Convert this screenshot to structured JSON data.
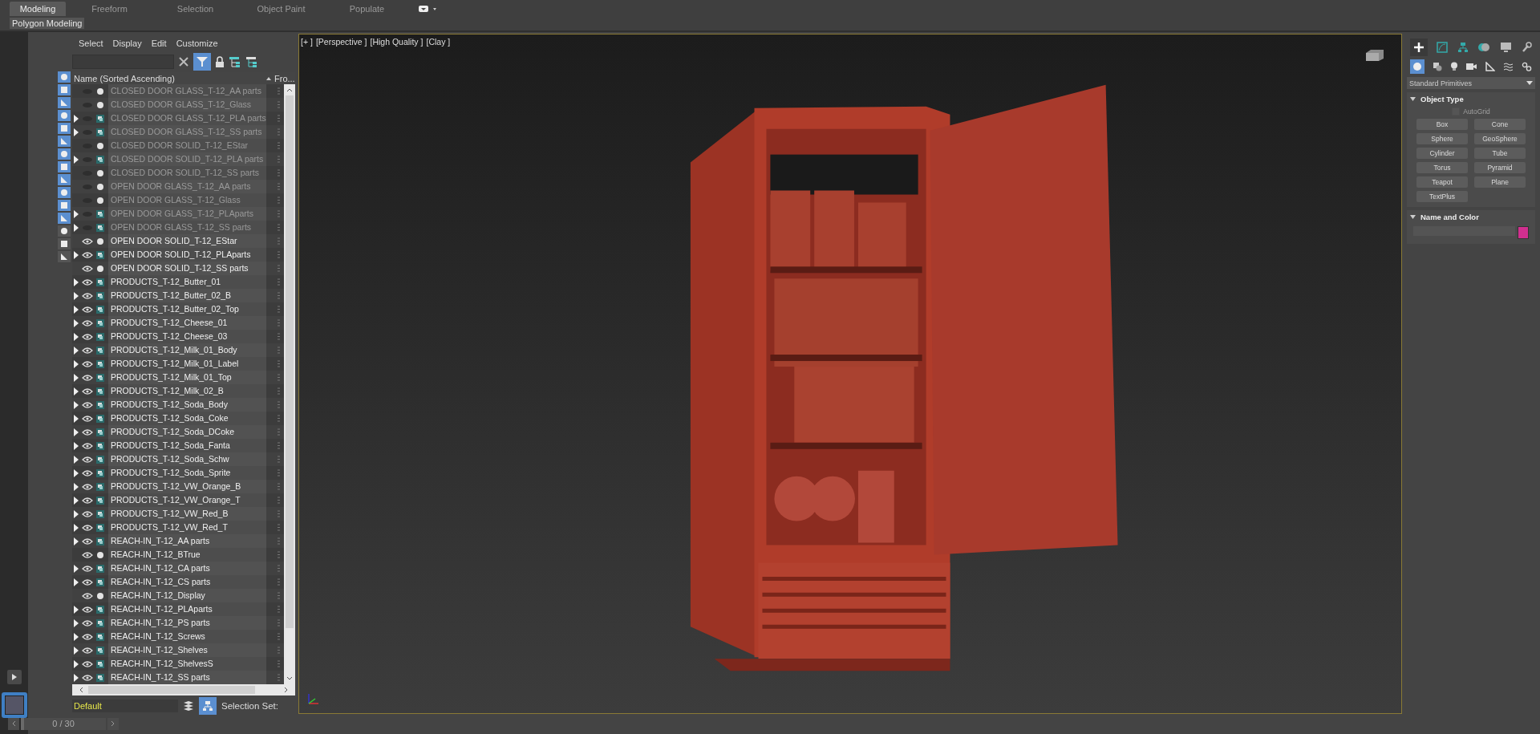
{
  "ribbon": {
    "tabs": [
      {
        "label": "Modeling",
        "selected": true
      },
      {
        "label": "Freeform",
        "selected": false
      },
      {
        "label": "Selection",
        "selected": false
      },
      {
        "label": "Object Paint",
        "selected": false
      },
      {
        "label": "Populate",
        "selected": false
      }
    ],
    "panel_label": "Polygon Modeling"
  },
  "scene_explorer": {
    "menu": [
      "Select",
      "Display",
      "Edit",
      "Customize"
    ],
    "column_name": "Name (Sorted Ascending)",
    "column_2": "Fro...",
    "filters": [
      {
        "on": true
      },
      {
        "on": true
      },
      {
        "on": true
      },
      {
        "on": true
      },
      {
        "on": true
      },
      {
        "on": true
      },
      {
        "on": true
      },
      {
        "on": true
      },
      {
        "on": true
      },
      {
        "on": true
      },
      {
        "on": true
      },
      {
        "on": true
      },
      {
        "on": false
      },
      {
        "on": false
      },
      {
        "on": false
      }
    ],
    "rows": [
      {
        "name": "CLOSED DOOR GLASS_T-12_AA parts",
        "kind": "object",
        "visible": false
      },
      {
        "name": "CLOSED DOOR GLASS_T-12_Glass",
        "kind": "object",
        "visible": false
      },
      {
        "name": "CLOSED DOOR GLASS_T-12_PLA parts",
        "kind": "group",
        "visible": false
      },
      {
        "name": "CLOSED DOOR GLASS_T-12_SS parts",
        "kind": "group",
        "visible": false
      },
      {
        "name": "CLOSED DOOR SOLID_T-12_EStar",
        "kind": "object",
        "visible": false
      },
      {
        "name": "CLOSED DOOR SOLID_T-12_PLA parts",
        "kind": "group",
        "visible": false
      },
      {
        "name": "CLOSED DOOR SOLID_T-12_SS parts",
        "kind": "object",
        "visible": false
      },
      {
        "name": "OPEN DOOR GLASS_T-12_AA parts",
        "kind": "object",
        "visible": false
      },
      {
        "name": "OPEN DOOR GLASS_T-12_Glass",
        "kind": "object",
        "visible": false
      },
      {
        "name": "OPEN DOOR GLASS_T-12_PLAparts",
        "kind": "group",
        "visible": false
      },
      {
        "name": "OPEN DOOR GLASS_T-12_SS parts",
        "kind": "group",
        "visible": false
      },
      {
        "name": "OPEN DOOR SOLID_T-12_EStar",
        "kind": "object",
        "visible": true
      },
      {
        "name": "OPEN DOOR SOLID_T-12_PLAparts",
        "kind": "group",
        "visible": true
      },
      {
        "name": "OPEN DOOR SOLID_T-12_SS parts",
        "kind": "object",
        "visible": true
      },
      {
        "name": "PRODUCTS_T-12_Butter_01",
        "kind": "group",
        "visible": true
      },
      {
        "name": "PRODUCTS_T-12_Butter_02_B",
        "kind": "group",
        "visible": true
      },
      {
        "name": "PRODUCTS_T-12_Butter_02_Top",
        "kind": "group",
        "visible": true
      },
      {
        "name": "PRODUCTS_T-12_Cheese_01",
        "kind": "group",
        "visible": true
      },
      {
        "name": "PRODUCTS_T-12_Cheese_03",
        "kind": "group",
        "visible": true
      },
      {
        "name": "PRODUCTS_T-12_Milk_01_Body",
        "kind": "group",
        "visible": true
      },
      {
        "name": "PRODUCTS_T-12_Milk_01_Label",
        "kind": "group",
        "visible": true
      },
      {
        "name": "PRODUCTS_T-12_Milk_01_Top",
        "kind": "group",
        "visible": true
      },
      {
        "name": "PRODUCTS_T-12_Milk_02_B",
        "kind": "group",
        "visible": true
      },
      {
        "name": "PRODUCTS_T-12_Soda_Body",
        "kind": "group",
        "visible": true
      },
      {
        "name": "PRODUCTS_T-12_Soda_Coke",
        "kind": "group",
        "visible": true
      },
      {
        "name": "PRODUCTS_T-12_Soda_DCoke",
        "kind": "group",
        "visible": true
      },
      {
        "name": "PRODUCTS_T-12_Soda_Fanta",
        "kind": "group",
        "visible": true
      },
      {
        "name": "PRODUCTS_T-12_Soda_Schw",
        "kind": "group",
        "visible": true
      },
      {
        "name": "PRODUCTS_T-12_Soda_Sprite",
        "kind": "group",
        "visible": true
      },
      {
        "name": "PRODUCTS_T-12_VW_Orange_B",
        "kind": "group",
        "visible": true
      },
      {
        "name": "PRODUCTS_T-12_VW_Orange_T",
        "kind": "group",
        "visible": true
      },
      {
        "name": "PRODUCTS_T-12_VW_Red_B",
        "kind": "group",
        "visible": true
      },
      {
        "name": "PRODUCTS_T-12_VW_Red_T",
        "kind": "group",
        "visible": true
      },
      {
        "name": "REACH-IN_T-12_AA parts",
        "kind": "group",
        "visible": true
      },
      {
        "name": "REACH-IN_T-12_BTrue",
        "kind": "object",
        "visible": true
      },
      {
        "name": "REACH-IN_T-12_CA parts",
        "kind": "group",
        "visible": true
      },
      {
        "name": "REACH-IN_T-12_CS parts",
        "kind": "group",
        "visible": true
      },
      {
        "name": "REACH-IN_T-12_Display",
        "kind": "object",
        "visible": true
      },
      {
        "name": "REACH-IN_T-12_PLAparts",
        "kind": "group",
        "visible": true
      },
      {
        "name": "REACH-IN_T-12_PS parts",
        "kind": "group",
        "visible": true
      },
      {
        "name": "REACH-IN_T-12_Screws",
        "kind": "group",
        "visible": true
      },
      {
        "name": "REACH-IN_T-12_Shelves",
        "kind": "group",
        "visible": true
      },
      {
        "name": "REACH-IN_T-12_ShelvesS",
        "kind": "group",
        "visible": true
      },
      {
        "name": "REACH-IN_T-12_SS parts",
        "kind": "group",
        "visible": true
      }
    ],
    "layer": "Default",
    "selection_set_label": "Selection Set:"
  },
  "viewport": {
    "labels": [
      "[+ ]",
      "[Perspective ]",
      "[High Quality ]",
      "[Clay ]"
    ]
  },
  "command_panel": {
    "dropdown": "Standard Primitives",
    "object_type": {
      "title": "Object Type",
      "expanded": true,
      "autogrid": {
        "label": "AutoGrid",
        "checked": false,
        "disabled": true
      },
      "buttons": [
        "Box",
        "Cone",
        "Sphere",
        "GeoSphere",
        "Cylinder",
        "Tube",
        "Torus",
        "Pyramid",
        "Teapot",
        "Plane",
        "TextPlus"
      ]
    },
    "name_and_color": {
      "title": "Name and Color",
      "expanded": true,
      "color": "#d12f8f"
    }
  },
  "timeline": {
    "frame": "0 / 30",
    "level": 0
  }
}
